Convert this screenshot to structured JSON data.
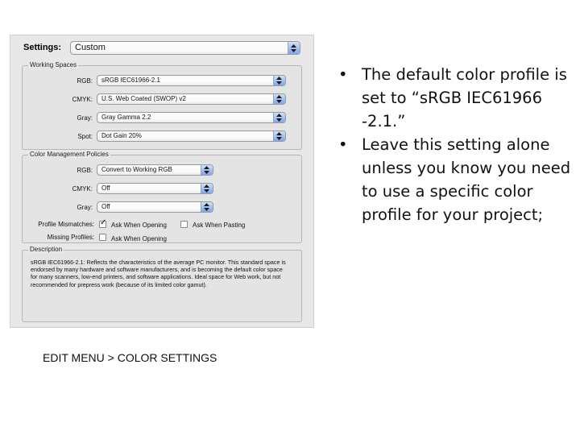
{
  "dialog": {
    "settings_label": "Settings:",
    "settings_value": "Custom",
    "working_spaces": {
      "title": "Working Spaces",
      "rgb_label": "RGB:",
      "rgb_value": "sRGB IEC61966-2.1",
      "cmyk_label": "CMYK:",
      "cmyk_value": "U.S. Web Coated (SWOP) v2",
      "gray_label": "Gray:",
      "gray_value": "Gray Gamma 2.2",
      "spot_label": "Spot:",
      "spot_value": "Dot Gain 20%"
    },
    "policies": {
      "title": "Color Management Policies",
      "rgb_label": "RGB:",
      "rgb_value": "Convert to Working RGB",
      "cmyk_label": "CMYK:",
      "cmyk_value": "Off",
      "gray_label": "Gray:",
      "gray_value": "Off",
      "mismatch_label": "Profile Mismatches:",
      "ask_opening": "Ask When Opening",
      "ask_pasting": "Ask When Pasting",
      "missing_label": "Missing Profiles:",
      "missing_ask_opening": "Ask When Opening"
    },
    "description": {
      "title": "Description",
      "text": "sRGB IEC61966-2.1:  Reflects the characteristics of the average PC monitor. This standard space is endorsed by many hardware and software manufacturers, and is becoming the default color space for many scanners, low-end printers, and software applications.  Ideal space for Web work, but not recommended for prepress work (because of its limited color gamut)."
    }
  },
  "bullets": [
    {
      "marker": "•",
      "text": " The default color profile is set to “sRGB IEC61966 -2.1.”"
    },
    {
      "marker": "•",
      "text": "Leave this setting alone unless you know you need to use a specific color profile for your project;"
    }
  ],
  "caption": "EDIT MENU > COLOR SETTINGS"
}
